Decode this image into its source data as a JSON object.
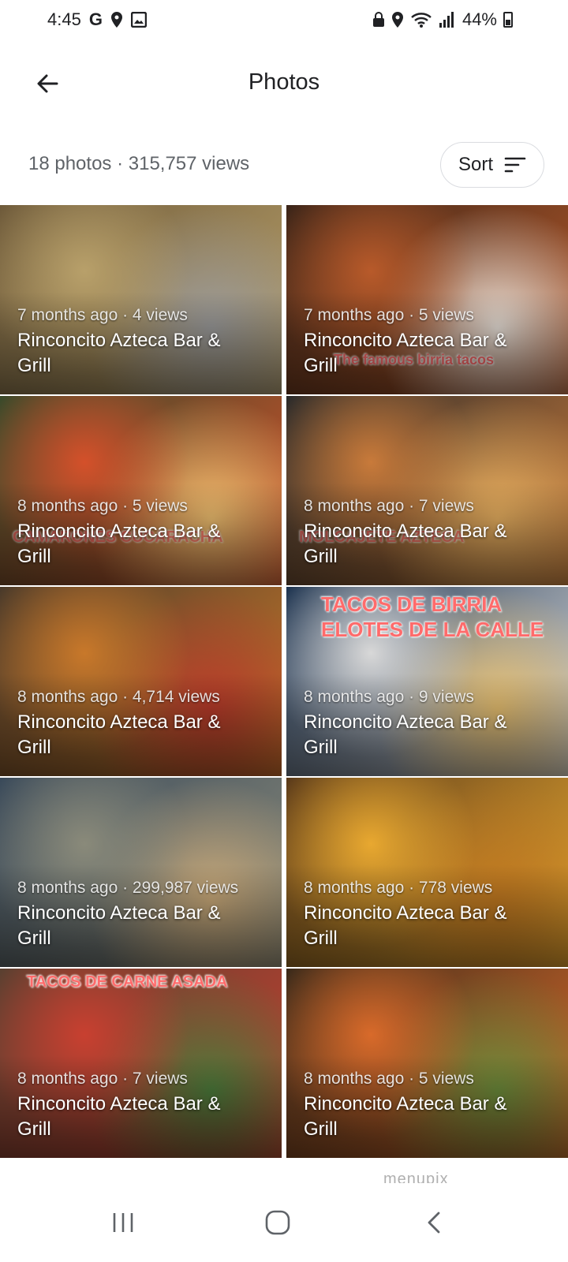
{
  "status_bar": {
    "time": "4:45",
    "g_label": "G",
    "battery": "44%"
  },
  "app_bar": {
    "title": "Photos",
    "back_icon": "arrow-back-icon"
  },
  "summary": {
    "text": "18 photos · 315,757 views",
    "sort_label": "Sort",
    "sort_icon": "sort-lines-icon"
  },
  "photos": [
    {
      "meta": "7 months ago · 4 views",
      "place": "Rinconcito Azteca Bar & Grill",
      "overlay": "",
      "colors": [
        "#6e5a3a",
        "#b8a06a",
        "#9a9a9a"
      ]
    },
    {
      "meta": "7 months ago · 5 views",
      "place": "Rinconcito Azteca Bar & Grill",
      "overlay": "The famous birria tacos",
      "colors": [
        "#3a2418",
        "#b85a2a",
        "#e8e0d8"
      ]
    },
    {
      "meta": "8 months ago · 5 views",
      "place": "Rinconcito Azteca Bar & Grill",
      "overlay": "CAMARONES CUCARACHA",
      "colors": [
        "#3a4a2a",
        "#d4502a",
        "#f0c070"
      ]
    },
    {
      "meta": "8 months ago · 7 views",
      "place": "Rinconcito Azteca Bar & Grill",
      "overlay": "MOLCAJETE AZTECA",
      "colors": [
        "#2a2a2a",
        "#c87a3a",
        "#e8b060"
      ]
    },
    {
      "meta": "8 months ago · 4,714 views",
      "place": "Rinconcito Azteca Bar & Grill",
      "overlay": "",
      "colors": [
        "#4a3a2a",
        "#c8782a",
        "#b83a2a"
      ]
    },
    {
      "meta": "8 months ago · 9 views",
      "place": "Rinconcito Azteca Bar & Grill",
      "overlay": "TACOS DE BIRRIA\nELOTES DE LA CALLE",
      "colors": [
        "#1e3450",
        "#d8d8d8",
        "#e8c070"
      ]
    },
    {
      "meta": "8 months ago · 299,987 views",
      "place": "Rinconcito Azteca Bar & Grill",
      "overlay": "",
      "colors": [
        "#3a4a5a",
        "#8a8a7a",
        "#c8a878"
      ]
    },
    {
      "meta": "8 months ago · 778 views",
      "place": "Rinconcito Azteca Bar & Grill",
      "overlay": "",
      "colors": [
        "#5a3a1a",
        "#e8a830",
        "#c07820"
      ]
    },
    {
      "meta": "8 months ago · 7 views",
      "place": "Rinconcito Azteca Bar & Grill",
      "overlay": "TACOS DE CARNE ASADA",
      "colors": [
        "#5a4030",
        "#c84030",
        "#4a7a3a"
      ]
    },
    {
      "meta": "8 months ago · 5 views",
      "place": "Rinconcito Azteca Bar & Grill",
      "overlay": "",
      "colors": [
        "#3a2a1a",
        "#d86a2a",
        "#6a8a3a"
      ]
    }
  ],
  "watermark": "menupix",
  "nav": {
    "recents_icon": "recents-icon",
    "home_icon": "home-icon",
    "back_icon": "nav-back-icon"
  }
}
